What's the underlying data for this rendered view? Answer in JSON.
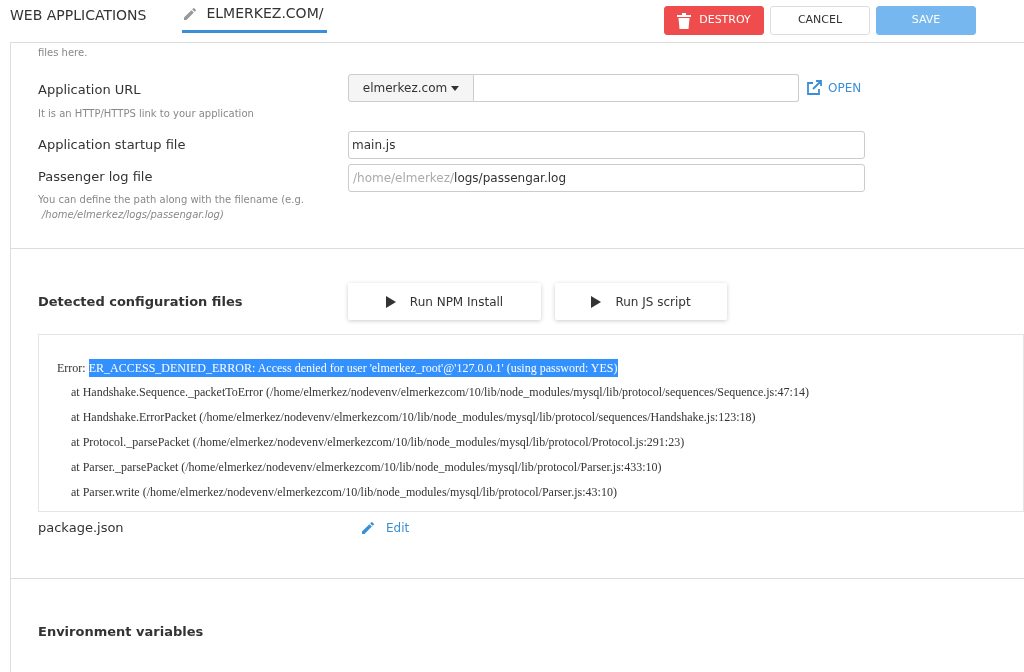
{
  "header": {
    "section": "WEB APPLICATIONS",
    "tab": "ELMERKEZ.COM/",
    "buttons": [
      {
        "label": "DESTROY",
        "kind": "danger"
      },
      {
        "label": "CANCEL",
        "kind": "default"
      },
      {
        "label": "SAVE",
        "kind": "primary",
        "disabled": true
      }
    ]
  },
  "settings": {
    "top_hint": "files here.",
    "url": {
      "label": "Application URL",
      "hint": "It is an HTTP/HTTPS link to your application",
      "domain": "elmerkez.com",
      "open": "OPEN"
    },
    "startup": {
      "label": "Application startup file",
      "value": "main.js"
    },
    "log": {
      "label": "Passenger log file",
      "prefix": "/home/elmerkez/",
      "value": "logs/passengar.log",
      "hint": "You can define the path along with the filename (e.g.",
      "hint_path": "/home/elmerkez/logs/passengar.log)"
    }
  },
  "config": {
    "title": "Detected configuration files",
    "actions": [
      "Run NPM Install",
      "Run JS script"
    ],
    "output": {
      "prefix": "Error: ",
      "selected_text": "ER_ACCESS_DENIED_ERROR: Access denied for user 'elmerkez_root'@'127.0.0.1' (using password: YES)",
      "lines": [
        "at Handshake.Sequence._packetToError (/home/elmerkez/nodevenv/elmerkezcom/10/lib/node_modules/mysql/lib/protocol/sequences/Sequence.js:47:14)",
        "at Handshake.ErrorPacket (/home/elmerkez/nodevenv/elmerkezcom/10/lib/node_modules/mysql/lib/protocol/sequences/Handshake.js:123:18)",
        "at Protocol._parsePacket (/home/elmerkez/nodevenv/elmerkezcom/10/lib/node_modules/mysql/lib/protocol/Protocol.js:291:23)",
        "at Parser._parsePacket (/home/elmerkez/nodevenv/elmerkezcom/10/lib/node_modules/mysql/lib/protocol/Parser.js:433:10)",
        "at Parser.write (/home/elmerkez/nodevenv/elmerkezcom/10/lib/node_modules/mysql/lib/protocol/Parser.js:43:10)"
      ]
    },
    "files": [
      {
        "name": "package.json",
        "action": "Edit"
      }
    ]
  },
  "env": {
    "title": "Environment variables"
  }
}
